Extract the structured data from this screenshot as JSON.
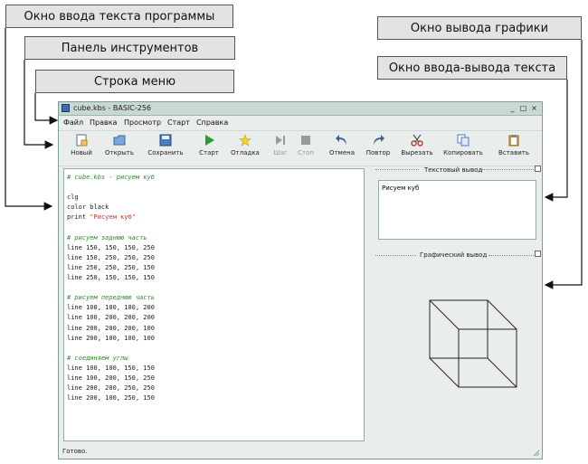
{
  "callouts": {
    "editor": "Окно ввода текста программы",
    "toolbar": "Панель инструментов",
    "menubar": "Строка меню",
    "graphics": "Окно вывода графики",
    "textio": "Окно ввода-вывода текста"
  },
  "window": {
    "title": "cube.kbs - BASIC-256",
    "minimize": "_",
    "maximize": "□",
    "close": "×"
  },
  "menu": [
    "Файл",
    "Правка",
    "Просмотр",
    "Старт",
    "Справка"
  ],
  "toolbar": [
    {
      "label": "Новый",
      "icon": "new-file-icon",
      "enabled": true
    },
    {
      "label": "Открыть",
      "icon": "open-folder-icon",
      "enabled": true
    },
    {
      "label": "Сохранить",
      "icon": "save-icon",
      "enabled": true
    },
    {
      "label": "Старт",
      "icon": "play-icon",
      "enabled": true
    },
    {
      "label": "Отладка",
      "icon": "debug-star-icon",
      "enabled": true
    },
    {
      "label": "Шаг",
      "icon": "step-icon",
      "enabled": false
    },
    {
      "label": "Стоп",
      "icon": "stop-icon",
      "enabled": false
    },
    {
      "label": "Отмена",
      "icon": "undo-icon",
      "enabled": true
    },
    {
      "label": "Повтор",
      "icon": "redo-icon",
      "enabled": true
    },
    {
      "label": "Вырезать",
      "icon": "scissors-icon",
      "enabled": true
    },
    {
      "label": "Копировать",
      "icon": "copy-icon",
      "enabled": true
    },
    {
      "label": "Вставить",
      "icon": "paste-icon",
      "enabled": true
    }
  ],
  "editor": {
    "lines": [
      {
        "t": "c",
        "text": "# cube.kbs - рисуем куб"
      },
      {
        "t": "k",
        "text": ""
      },
      {
        "t": "k",
        "text": "clg"
      },
      {
        "t": "k",
        "text": "color black"
      },
      {
        "t": "p",
        "text": "print ",
        "str": "\"Рисуем куб\""
      },
      {
        "t": "k",
        "text": ""
      },
      {
        "t": "c",
        "text": "# рисуем заднюю часть"
      },
      {
        "t": "k",
        "text": "line 150, 150, 150, 250"
      },
      {
        "t": "k",
        "text": "line 150, 250, 250, 250"
      },
      {
        "t": "k",
        "text": "line 250, 250, 250, 150"
      },
      {
        "t": "k",
        "text": "line 250, 150, 150, 150"
      },
      {
        "t": "k",
        "text": ""
      },
      {
        "t": "c",
        "text": "# рисуем переднюю часть"
      },
      {
        "t": "k",
        "text": "line 100, 100, 100, 200"
      },
      {
        "t": "k",
        "text": "line 100, 200, 200, 200"
      },
      {
        "t": "k",
        "text": "line 200, 200, 200, 100"
      },
      {
        "t": "k",
        "text": "line 200, 100, 100, 100"
      },
      {
        "t": "k",
        "text": ""
      },
      {
        "t": "c",
        "text": "# соединяем углы"
      },
      {
        "t": "k",
        "text": "line 100, 100, 150, 150"
      },
      {
        "t": "k",
        "text": "line 100, 200, 150, 250"
      },
      {
        "t": "k",
        "text": "line 200, 200, 250, 250"
      },
      {
        "t": "k",
        "text": "line 200, 100, 250, 150"
      }
    ]
  },
  "text_output": {
    "title": "Текстовый вывод",
    "content": "Рисуем куб"
  },
  "graphics_output": {
    "title": "Графический вывод"
  },
  "status": "Готово."
}
